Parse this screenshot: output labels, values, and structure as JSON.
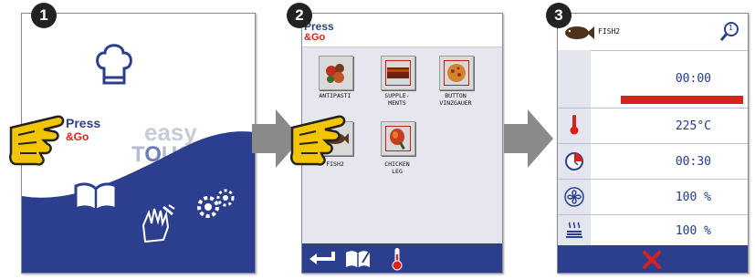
{
  "steps": [
    "1",
    "2",
    "3"
  ],
  "panel1": {
    "press": "Press",
    "go": "&Go",
    "easy": "easy",
    "touch_t": "T",
    "touch_o": "O",
    "touch_rest": "UCH"
  },
  "panel2": {
    "press": "Press",
    "go": "&Go",
    "programs": [
      {
        "label": "ANTIPASTI"
      },
      {
        "label": "SUPPLE-\nMENTS"
      },
      {
        "label": "BUTTON\nVINZGAUER"
      },
      {
        "label": "FISH2"
      },
      {
        "label": "CHICKEN\nLEG"
      }
    ]
  },
  "panel3": {
    "title": "FISH2",
    "info_badge": "1",
    "timer": "00:00",
    "progress_fraction": 0.0,
    "temperature": "225°C",
    "cook_time": "00:30",
    "fan_speed": "100 %",
    "humidity": "100 %"
  },
  "colors": {
    "brand_blue": "#2b3f8e",
    "brand_red": "#d9211b",
    "text_blue": "#233a86",
    "hand_yellow": "#f3c400"
  }
}
